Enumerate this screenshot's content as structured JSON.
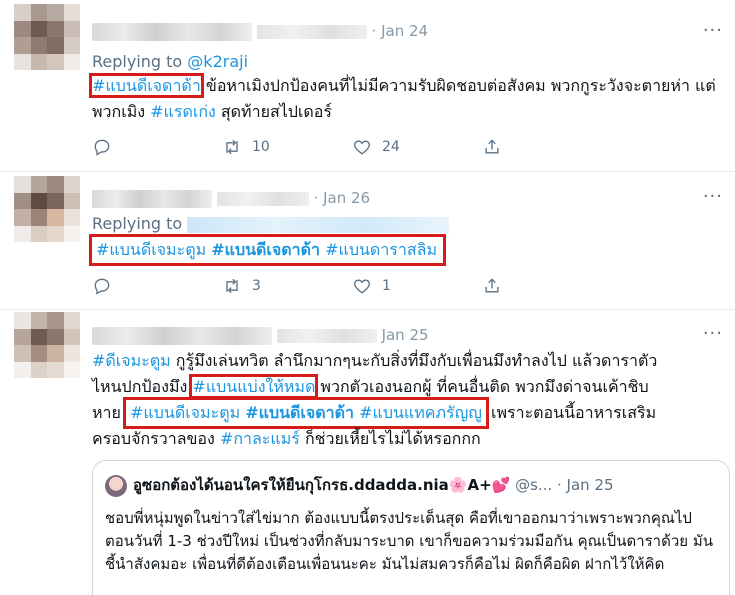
{
  "tweets": [
    {
      "date": "· Jan 24",
      "reply_prefix": "Replying to",
      "reply_to": "@k2raji",
      "body": {
        "h1": "#แบนดีเจดาด้า",
        "t1": " ข้อหาเมิงปกป้องคนที่ไม่มีความรับผิดชอบต่อสังคม พวกกูระวังจะตายห่า แต่พวกเมิง ",
        "h2": "#แรดเก่ง",
        "t2": " สุดท้ายสไปเดอร์"
      },
      "reply_count": "",
      "retweet_count": "10",
      "like_count": "24"
    },
    {
      "date": "· Jan 26",
      "reply_prefix": "Replying to",
      "body": {
        "h1": "#แบนดีเจมะตูม",
        "h2": "#แบนดีเจดาด้า",
        "h3": "#แบนดาราสลิม"
      },
      "reply_count": "",
      "retweet_count": "3",
      "like_count": "1"
    },
    {
      "date": "Jan 25",
      "body": {
        "h1": "#ดีเจมะตูม",
        "t1": " กูรู้มึงเล่นทวิต ลำนึกมากๆนะกับสิ่งที่มึงกับเพื่อนมึงทำลงไป แล้วดาราตัว",
        "t2": "ไหนปกป้องมึง ",
        "h2": "#แบนแบ่งให้หมด",
        "t3": " พวกตัวเองนอกผู้ ที่คนอื่นติด พวกมึงด่าจนเค้าชิบ",
        "t4": "หาย ",
        "h3": "#แบนดีเจมะตูม",
        "h4": "#แบนดีเจดาด้า",
        "h5": "#แบนแทคภรัญญู",
        "t5": " เพราะตอนนี้อาหารเสริม",
        "t6": "ครอบจักรวาลของ ",
        "h6": "#กาละแมร์",
        "t7": " ก็ช่วยเหี้ยไรไม่ได้หรอกกก"
      },
      "quote": {
        "name": "อูซอกต้องได้นอนใครให้ยืนกุโกรธ.ddadda.nia🌸A+💕",
        "handle": "@s...",
        "date": "· Jan 25",
        "body": "ชอบพี่หนุ่มพูดในข่าวใส่ไข่มาก ต้องแบบนี้ตรงประเด็นสุด คือที่เขาออกมาว่าเพราะพวกคุณไปตอนวันที่ 1-3 ช่วงปีใหม่ เป็นช่วงที่กลับมาระบาด เขาก็ขอความร่วมมือกัน คุณเป็นดาราด้วย มันชี้นำสังคมอะ เพื่อนที่ดีต้องเตือนเพื่อนนะคะ มันไม่สมควรก็คือไม่ ผิดก็คือผิด ฝากไว้ให้คิด"
      }
    }
  ],
  "more_label": "···",
  "colors": {
    "link": "#1b95e0",
    "highlight": "#d71a1a",
    "muted": "#5b7083"
  }
}
